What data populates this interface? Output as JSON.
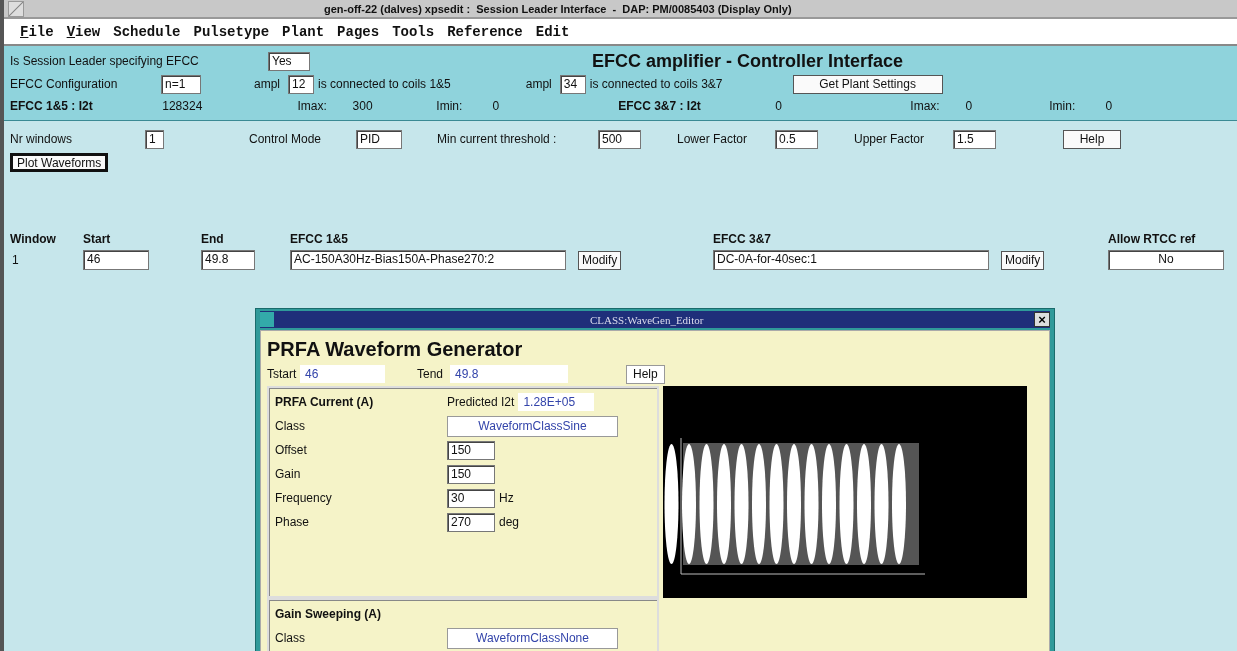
{
  "window": {
    "title": "gen-off-22 (dalves) xpsedit :  Session Leader Interface  -  DAP: PM/0085403 (Display Only)"
  },
  "menu": [
    {
      "label": "File",
      "mnemonic": true
    },
    {
      "label": "View",
      "mnemonic": true
    },
    {
      "label": "Schedule",
      "mnemonic": false
    },
    {
      "label": "Pulsetype",
      "mnemonic": false
    },
    {
      "label": "Plant",
      "mnemonic": false
    },
    {
      "label": "Pages",
      "mnemonic": false
    },
    {
      "label": "Tools",
      "mnemonic": false
    },
    {
      "label": "Reference",
      "mnemonic": false
    },
    {
      "label": "Edit",
      "mnemonic": false
    }
  ],
  "header": {
    "title": "EFCC amplifier - Controller Interface",
    "leader_label": "Is Session Leader specifying EFCC",
    "leader_value": "Yes",
    "config_label": "EFCC Configuration",
    "config_value": "n=1",
    "amplifiers": [
      {
        "prefix": "ampl",
        "value": "12",
        "suffix": "is connected to coils 1&5"
      },
      {
        "prefix": "ampl",
        "value": "34",
        "suffix": "is connected to coils 3&7"
      }
    ],
    "plant_button": "Get Plant Settings",
    "i2t": [
      {
        "label": "EFCC 1&5 : I2t",
        "value": "128324",
        "imax_label": "Imax:",
        "imax": "300",
        "imin_label": "Imin:",
        "imin": "0"
      },
      {
        "label": "EFCC 3&7 : I2t",
        "value": "0",
        "imax_label": "Imax:",
        "imax": "0",
        "imin_label": "Imin:",
        "imin": "0"
      }
    ]
  },
  "controls": {
    "fields": [
      {
        "label": "Nr windows",
        "value": "1"
      },
      {
        "label": "Control Mode",
        "value": "PID"
      },
      {
        "label": "Min current threshold :",
        "value": "500"
      },
      {
        "label": "Lower Factor",
        "value": "0.5"
      },
      {
        "label": "Upper Factor",
        "value": "1.5"
      }
    ],
    "help_button": "Help",
    "plot_button": "Plot Waveforms"
  },
  "windows_table": {
    "columns": [
      "Window",
      "Start",
      "End",
      "EFCC 1&5",
      "EFCC 3&7",
      "Allow RTCC ref"
    ],
    "rows": [
      {
        "window": "1",
        "start": "46",
        "end": "49.8",
        "efcc_15": "AC-150A30Hz-Bias150A-Phase270:2",
        "efcc_15_button": "Modify",
        "efcc_37": "DC-0A-for-40sec:1",
        "efcc_37_button": "Modify",
        "allow_rtcc": "No"
      }
    ]
  },
  "dialog": {
    "title": "CLASS:WaveGen_Editor",
    "close": "×",
    "heading": "PRFA Waveform Generator",
    "tstart_label": "Tstart",
    "tstart": "46",
    "tend_label": "Tend",
    "tend": "49.8",
    "help_button": "Help",
    "current": {
      "title": "PRFA Current (A)",
      "predicted_label": "Predicted I2t",
      "predicted": "1.28E+05",
      "class_label": "Class",
      "class_value": "WaveformClassSine",
      "params": [
        {
          "label": "Offset",
          "value": "150"
        },
        {
          "label": "Gain",
          "value": "150"
        },
        {
          "label": "Frequency",
          "value": "30",
          "unit": "Hz"
        },
        {
          "label": "Phase",
          "value": "270",
          "unit": "deg"
        }
      ]
    },
    "sweep": {
      "title": "Gain Sweeping (A)",
      "class_label": "Class",
      "class_value": "WaveformClassNone"
    }
  }
}
